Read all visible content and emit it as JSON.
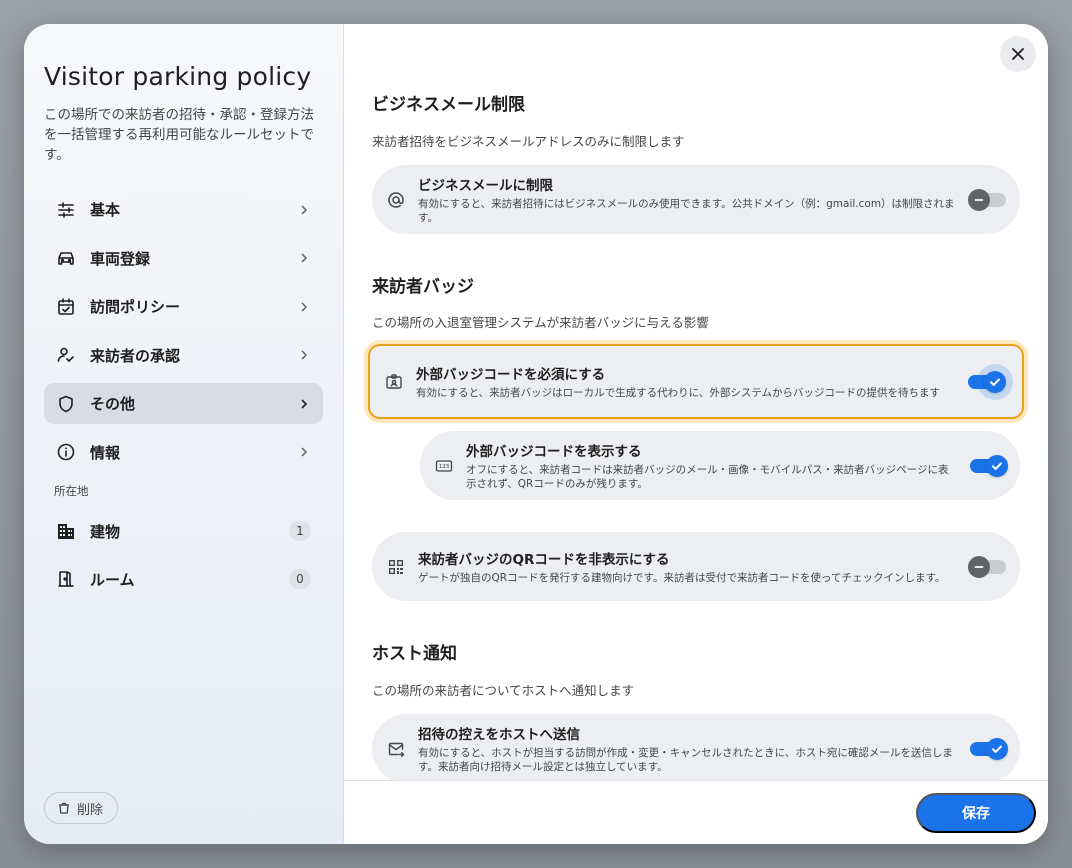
{
  "sidebar": {
    "title": "Visitor parking policy",
    "description": "この場所での来訪者の招待・承認・登録方法を一括管理する再利用可能なルールセットです。",
    "nav": [
      {
        "label": "基本",
        "icon": "sliders-icon"
      },
      {
        "label": "車両登録",
        "icon": "car-icon"
      },
      {
        "label": "訪問ポリシー",
        "icon": "calendar-check-icon"
      },
      {
        "label": "来訪者の承認",
        "icon": "person-check-icon"
      },
      {
        "label": "その他",
        "icon": "shield-icon",
        "active": true
      },
      {
        "label": "情報",
        "icon": "info-icon"
      }
    ],
    "location_label": "所在地",
    "locations": [
      {
        "label": "建物",
        "count": "1",
        "icon": "building-icon"
      },
      {
        "label": "ルーム",
        "count": "0",
        "icon": "door-icon"
      }
    ],
    "delete_label": "削除"
  },
  "main": {
    "sections": {
      "business": {
        "heading": "ビジネスメール制限",
        "sub": "来訪者招待をビジネスメールアドレスのみに制限します",
        "card": {
          "title": "ビジネスメールに制限",
          "desc": "有効にすると、来訪者招待にはビジネスメールのみ使用できます。公共ドメイン（例：gmail.com）は制限されます。",
          "enabled": false
        }
      },
      "badge": {
        "heading": "来訪者バッジ",
        "sub": "この場所の入退室管理システムが来訪者バッジに与える影響",
        "cards": [
          {
            "title": "外部バッジコードを必須にする",
            "desc": "有効にすると、来訪者バッジはローカルで生成する代わりに、外部システムからバッジコードの提供を待ちます",
            "enabled": true
          },
          {
            "title": "外部バッジコードを表示する",
            "desc": "オフにすると、来訪者コードは来訪者バッジのメール・画像・モバイルパス・来訪者バッジページに表示されず、QRコードのみが残ります。",
            "enabled": true
          },
          {
            "title": "来訪者バッジのQRコードを非表示にする",
            "desc": "ゲートが独自のQRコードを発行する建物向けです。来訪者は受付で来訪者コードを使ってチェックインします。",
            "enabled": false
          }
        ]
      },
      "host": {
        "heading": "ホスト通知",
        "sub": "この場所の来訪者についてホストへ通知します",
        "card": {
          "title": "招待の控えをホストへ送信",
          "desc": "有効にすると、ホストが担当する訪問が作成・変更・キャンセルされたときに、ホスト宛に確認メールを送信します。来訪者向け招待メール設定とは独立しています。",
          "enabled": true
        }
      }
    },
    "save_label": "保存"
  },
  "colors": {
    "accent": "#1a73e8",
    "focus_ring": "#e8a21c"
  }
}
